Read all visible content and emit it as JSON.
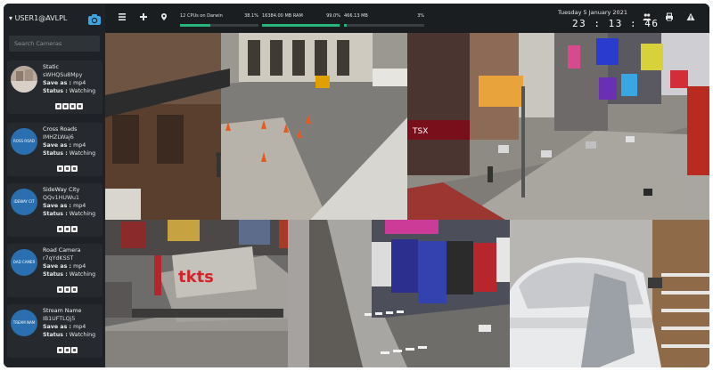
{
  "header": {
    "user": "USER1@AVLPL",
    "search_placeholder": "Search Cameras",
    "date": "Tuesday 5 January 2021",
    "time": "23 : 13 : 46"
  },
  "labels": {
    "save_as": "Save as :",
    "status": "Status :"
  },
  "cameras": [
    {
      "name": "Static",
      "id": "sWHQSu8Mpy",
      "save_as": "mp4",
      "status": "Watching",
      "thumb": ""
    },
    {
      "name": "Cross Roads",
      "id": "IMHZLWaj6",
      "save_as": "mp4",
      "status": "Watching",
      "thumb": "ROSS ROAD"
    },
    {
      "name": "SideWay City",
      "id": "QQv1HUWu1",
      "save_as": "mp4",
      "status": "Watching",
      "thumb": "IDEWAY CIT"
    },
    {
      "name": "Road Camera",
      "id": "r7qYdKSST",
      "save_as": "mp4",
      "status": "Watching",
      "thumb": "OAD CAMER"
    },
    {
      "name": "Stream Name",
      "id": "IB1UFTLQj5",
      "save_as": "mp4",
      "status": "Watching",
      "thumb": "TREAM NAM"
    }
  ],
  "meters": {
    "cpu": {
      "label": "12 CPUs on Darwin",
      "percent_text": "38.1%",
      "fraction": 0.381
    },
    "ram": {
      "label": "16384.00 MB RAM",
      "percent_text": "99.0%",
      "fraction": 0.99
    },
    "disk": {
      "label": "466.13 MB",
      "percent_text": "3%",
      "fraction": 0.03
    }
  },
  "video_text": {
    "tkts": "tkts",
    "tsx": "TSX"
  },
  "colors": {
    "accent": "#28b37a",
    "thumb_blue": "#2a6fb0",
    "camera_icon": "#3da5e0"
  }
}
